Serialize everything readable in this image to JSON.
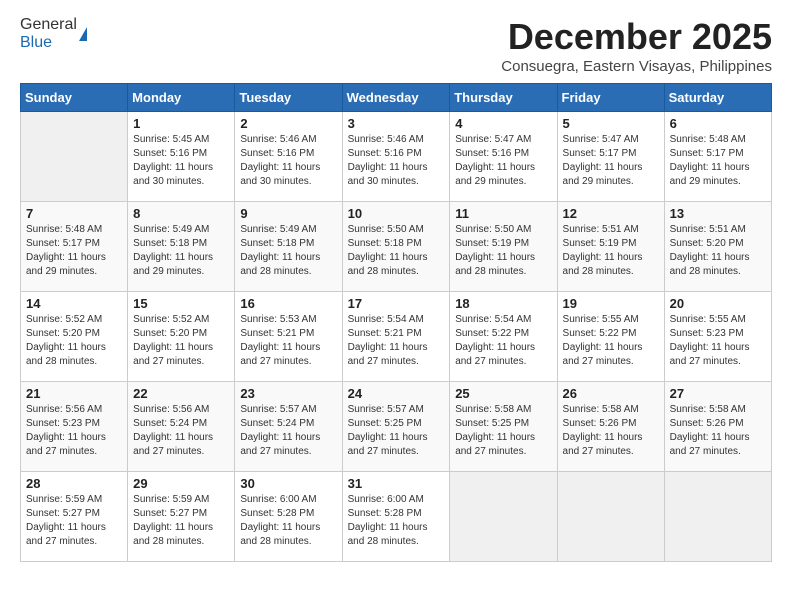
{
  "header": {
    "logo_general": "General",
    "logo_blue": "Blue",
    "month_title": "December 2025",
    "location": "Consuegra, Eastern Visayas, Philippines"
  },
  "days_of_week": [
    "Sunday",
    "Monday",
    "Tuesday",
    "Wednesday",
    "Thursday",
    "Friday",
    "Saturday"
  ],
  "weeks": [
    [
      {
        "day": "",
        "info": ""
      },
      {
        "day": "1",
        "info": "Sunrise: 5:45 AM\nSunset: 5:16 PM\nDaylight: 11 hours\nand 30 minutes."
      },
      {
        "day": "2",
        "info": "Sunrise: 5:46 AM\nSunset: 5:16 PM\nDaylight: 11 hours\nand 30 minutes."
      },
      {
        "day": "3",
        "info": "Sunrise: 5:46 AM\nSunset: 5:16 PM\nDaylight: 11 hours\nand 30 minutes."
      },
      {
        "day": "4",
        "info": "Sunrise: 5:47 AM\nSunset: 5:16 PM\nDaylight: 11 hours\nand 29 minutes."
      },
      {
        "day": "5",
        "info": "Sunrise: 5:47 AM\nSunset: 5:17 PM\nDaylight: 11 hours\nand 29 minutes."
      },
      {
        "day": "6",
        "info": "Sunrise: 5:48 AM\nSunset: 5:17 PM\nDaylight: 11 hours\nand 29 minutes."
      }
    ],
    [
      {
        "day": "7",
        "info": "Sunrise: 5:48 AM\nSunset: 5:17 PM\nDaylight: 11 hours\nand 29 minutes."
      },
      {
        "day": "8",
        "info": "Sunrise: 5:49 AM\nSunset: 5:18 PM\nDaylight: 11 hours\nand 29 minutes."
      },
      {
        "day": "9",
        "info": "Sunrise: 5:49 AM\nSunset: 5:18 PM\nDaylight: 11 hours\nand 28 minutes."
      },
      {
        "day": "10",
        "info": "Sunrise: 5:50 AM\nSunset: 5:18 PM\nDaylight: 11 hours\nand 28 minutes."
      },
      {
        "day": "11",
        "info": "Sunrise: 5:50 AM\nSunset: 5:19 PM\nDaylight: 11 hours\nand 28 minutes."
      },
      {
        "day": "12",
        "info": "Sunrise: 5:51 AM\nSunset: 5:19 PM\nDaylight: 11 hours\nand 28 minutes."
      },
      {
        "day": "13",
        "info": "Sunrise: 5:51 AM\nSunset: 5:20 PM\nDaylight: 11 hours\nand 28 minutes."
      }
    ],
    [
      {
        "day": "14",
        "info": "Sunrise: 5:52 AM\nSunset: 5:20 PM\nDaylight: 11 hours\nand 28 minutes."
      },
      {
        "day": "15",
        "info": "Sunrise: 5:52 AM\nSunset: 5:20 PM\nDaylight: 11 hours\nand 27 minutes."
      },
      {
        "day": "16",
        "info": "Sunrise: 5:53 AM\nSunset: 5:21 PM\nDaylight: 11 hours\nand 27 minutes."
      },
      {
        "day": "17",
        "info": "Sunrise: 5:54 AM\nSunset: 5:21 PM\nDaylight: 11 hours\nand 27 minutes."
      },
      {
        "day": "18",
        "info": "Sunrise: 5:54 AM\nSunset: 5:22 PM\nDaylight: 11 hours\nand 27 minutes."
      },
      {
        "day": "19",
        "info": "Sunrise: 5:55 AM\nSunset: 5:22 PM\nDaylight: 11 hours\nand 27 minutes."
      },
      {
        "day": "20",
        "info": "Sunrise: 5:55 AM\nSunset: 5:23 PM\nDaylight: 11 hours\nand 27 minutes."
      }
    ],
    [
      {
        "day": "21",
        "info": "Sunrise: 5:56 AM\nSunset: 5:23 PM\nDaylight: 11 hours\nand 27 minutes."
      },
      {
        "day": "22",
        "info": "Sunrise: 5:56 AM\nSunset: 5:24 PM\nDaylight: 11 hours\nand 27 minutes."
      },
      {
        "day": "23",
        "info": "Sunrise: 5:57 AM\nSunset: 5:24 PM\nDaylight: 11 hours\nand 27 minutes."
      },
      {
        "day": "24",
        "info": "Sunrise: 5:57 AM\nSunset: 5:25 PM\nDaylight: 11 hours\nand 27 minutes."
      },
      {
        "day": "25",
        "info": "Sunrise: 5:58 AM\nSunset: 5:25 PM\nDaylight: 11 hours\nand 27 minutes."
      },
      {
        "day": "26",
        "info": "Sunrise: 5:58 AM\nSunset: 5:26 PM\nDaylight: 11 hours\nand 27 minutes."
      },
      {
        "day": "27",
        "info": "Sunrise: 5:58 AM\nSunset: 5:26 PM\nDaylight: 11 hours\nand 27 minutes."
      }
    ],
    [
      {
        "day": "28",
        "info": "Sunrise: 5:59 AM\nSunset: 5:27 PM\nDaylight: 11 hours\nand 27 minutes."
      },
      {
        "day": "29",
        "info": "Sunrise: 5:59 AM\nSunset: 5:27 PM\nDaylight: 11 hours\nand 28 minutes."
      },
      {
        "day": "30",
        "info": "Sunrise: 6:00 AM\nSunset: 5:28 PM\nDaylight: 11 hours\nand 28 minutes."
      },
      {
        "day": "31",
        "info": "Sunrise: 6:00 AM\nSunset: 5:28 PM\nDaylight: 11 hours\nand 28 minutes."
      },
      {
        "day": "",
        "info": ""
      },
      {
        "day": "",
        "info": ""
      },
      {
        "day": "",
        "info": ""
      }
    ]
  ]
}
